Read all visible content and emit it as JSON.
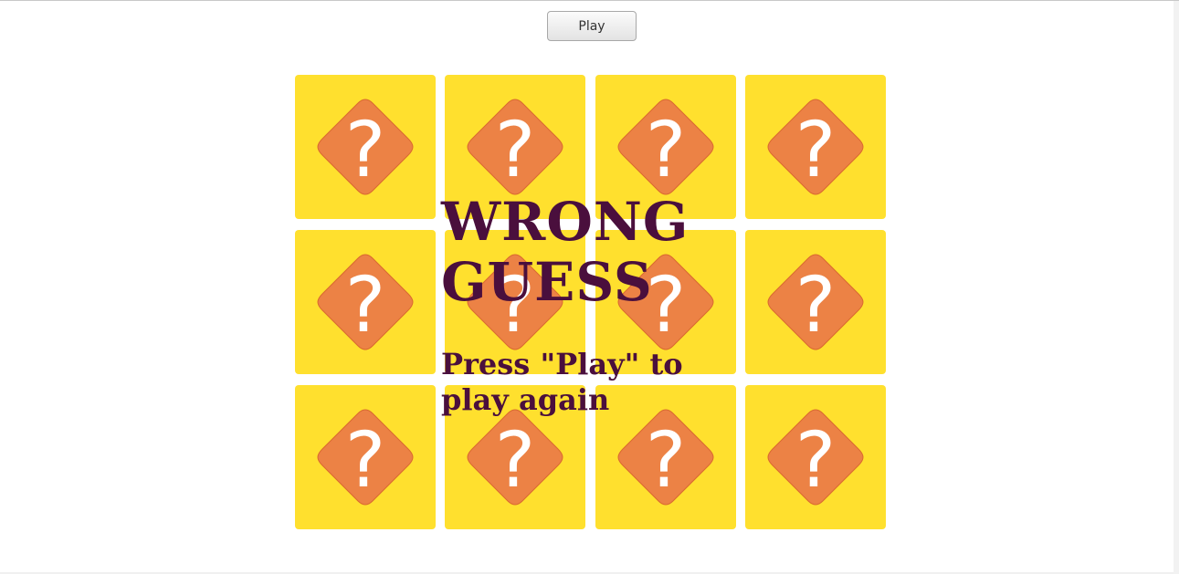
{
  "toolbar": {
    "play_label": "Play"
  },
  "board": {
    "rows": 3,
    "columns": 4,
    "cards": [
      {
        "face": "?",
        "state": "face-down"
      },
      {
        "face": "?",
        "state": "face-down"
      },
      {
        "face": "?",
        "state": "face-down"
      },
      {
        "face": "?",
        "state": "face-down"
      },
      {
        "face": "?",
        "state": "face-down"
      },
      {
        "face": "?",
        "state": "face-down"
      },
      {
        "face": "?",
        "state": "face-down"
      },
      {
        "face": "?",
        "state": "face-down"
      },
      {
        "face": "?",
        "state": "face-down"
      },
      {
        "face": "?",
        "state": "face-down"
      },
      {
        "face": "?",
        "state": "face-down"
      },
      {
        "face": "?",
        "state": "face-down"
      }
    ],
    "card_icon": "question-mark-diamond-icon"
  },
  "message": {
    "title": "WRONG GUESS",
    "subtitle": "Press \"Play\" to play again"
  },
  "colors": {
    "card_background": "#ffe02e",
    "icon_diamond": "#ec8245",
    "icon_glyph": "#ffffff",
    "message_text": "#4a0f3d"
  }
}
